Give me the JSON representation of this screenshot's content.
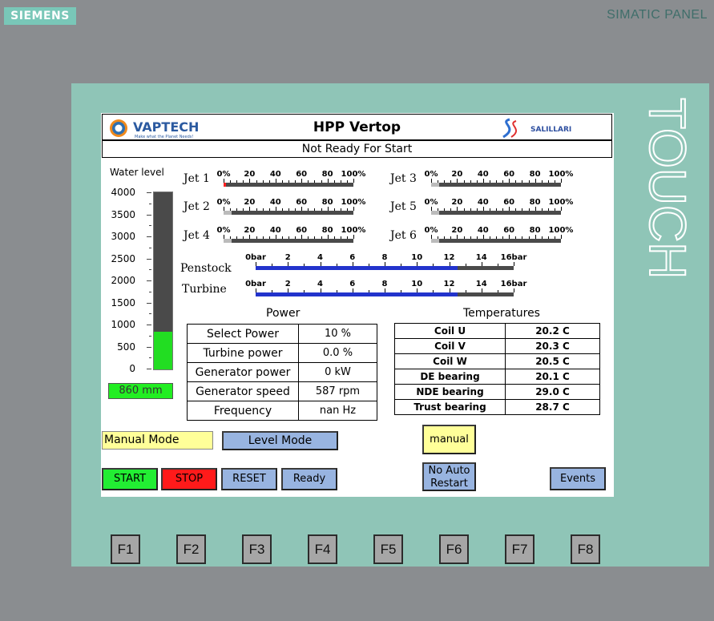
{
  "device": {
    "brand": "SIEMENS",
    "model": "SIMATIC PANEL",
    "bezel_text": "TOUCH"
  },
  "header": {
    "logo_left": "VAPTECH",
    "logo_left_tagline": "Make what the Planet Needs!",
    "title": "HPP Vertop",
    "logo_right": "SALILLARI"
  },
  "status": "Not Ready For Start",
  "water_level": {
    "label": "Water level",
    "scale": [
      "4000",
      "3500",
      "3000",
      "2500",
      "2000",
      "1500",
      "1000",
      "500",
      "0"
    ],
    "max": 4000,
    "fill_value": 860,
    "value": "860 mm"
  },
  "jets": [
    {
      "label": "Jet 1",
      "value_pct": 2,
      "fill_color": "#ff2020"
    },
    {
      "label": "Jet 2",
      "value_pct": 6,
      "fill_color": "#bbbbbb"
    },
    {
      "label": "Jet 4",
      "value_pct": 6,
      "fill_color": "#bbbbbb"
    },
    {
      "label": "Jet 3",
      "value_pct": 6,
      "fill_color": "#bbbbbb"
    },
    {
      "label": "Jet 5",
      "value_pct": 6,
      "fill_color": "#bbbbbb"
    },
    {
      "label": "Jet 6",
      "value_pct": 6,
      "fill_color": "#bbbbbb"
    }
  ],
  "jet_scale": [
    "0%",
    "20",
    "40",
    "60",
    "80",
    "100%"
  ],
  "pressure_scale": [
    "0bar",
    "2",
    "4",
    "6",
    "8",
    "10",
    "12",
    "14",
    "16bar"
  ],
  "pressures": [
    {
      "label": "Penstock",
      "value_bar": 12.5,
      "fill_color": "#2233cc"
    },
    {
      "label": "Turbine",
      "value_bar": 12.5,
      "fill_color": "#2233cc"
    }
  ],
  "power": {
    "title": "Power",
    "rows": [
      {
        "name": "Select Power",
        "value": "10 %"
      },
      {
        "name": "Turbine power",
        "value": "0.0 %"
      },
      {
        "name": "Generator power",
        "value": "0 kW"
      },
      {
        "name": "Generator speed",
        "value": "587 rpm"
      },
      {
        "name": "Frequency",
        "value": "nan Hz"
      }
    ]
  },
  "temperatures": {
    "title": "Temperatures",
    "rows": [
      {
        "name": "Coil U",
        "value": "20.2 C"
      },
      {
        "name": "Coil V",
        "value": "20.3 C"
      },
      {
        "name": "Coil W",
        "value": "20.5 C"
      },
      {
        "name": "DE bearing",
        "value": "20.1 C"
      },
      {
        "name": "NDE bearing",
        "value": "29.0 C"
      },
      {
        "name": "Trust bearing",
        "value": "28.7 C"
      }
    ]
  },
  "mode": {
    "manual_mode": "Manual Mode",
    "level_mode": "Level Mode",
    "manual": "manual"
  },
  "buttons": {
    "start": "START",
    "stop": "STOP",
    "reset": "RESET",
    "ready": "Ready",
    "no_auto_restart": "No Auto Restart",
    "events": "Events"
  },
  "colors": {
    "start": "#22ee33",
    "stop": "#ff1a1a",
    "blue_btn": "#98b4e0",
    "yellow": "#ffff99",
    "green": "#22ee22"
  },
  "fkeys": [
    "F1",
    "F2",
    "F3",
    "F4",
    "F5",
    "F6",
    "F7",
    "F8"
  ]
}
